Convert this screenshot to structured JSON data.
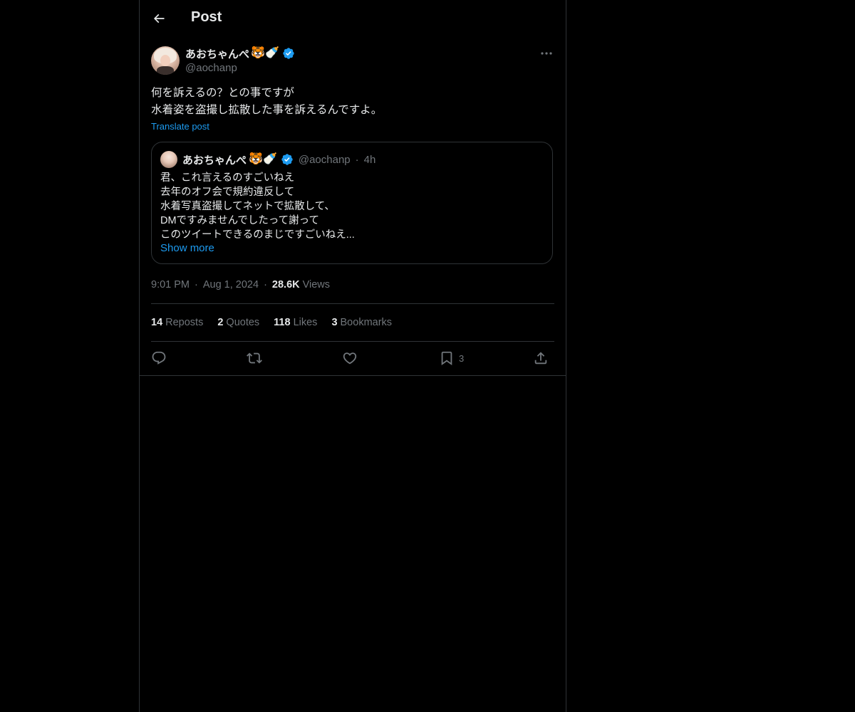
{
  "header": {
    "title": "Post",
    "back_icon": "arrow-left-icon"
  },
  "post": {
    "author": {
      "display_name": "あおちゃんぺ",
      "emojis": "🐯🍼",
      "verified": true,
      "handle": "@aochanp"
    },
    "text_lines": [
      "何を訴えるの？との事ですが",
      "水着姿を盗撮し拡散した事を訴えるんですよ。"
    ],
    "translate_label": "Translate post",
    "quoted": {
      "display_name": "あおちゃんぺ",
      "emojis": "🐯🍼",
      "verified": true,
      "handle": "@aochanp",
      "separator": "·",
      "time": "4h",
      "text_lines": [
        "君、これ言えるのすごいねえ",
        "去年のオフ会で規約違反して",
        "水着写真盗撮してネットで拡散して、",
        "DMですみませんでしたって謝って",
        "このツイートできるのまじですごいねえ..."
      ],
      "show_more_label": "Show more"
    },
    "meta": {
      "time": "9:01 PM",
      "separator": "·",
      "date": "Aug 1, 2024",
      "views_count": "28.6K",
      "views_label": "Views"
    },
    "stats": {
      "reposts_count": "14",
      "reposts_label": "Reposts",
      "quotes_count": "2",
      "quotes_label": "Quotes",
      "likes_count": "118",
      "likes_label": "Likes",
      "bookmarks_count": "3",
      "bookmarks_label": "Bookmarks"
    },
    "actions": {
      "reply_icon": "reply-icon",
      "repost_icon": "repost-icon",
      "like_icon": "heart-icon",
      "bookmark_icon": "bookmark-icon",
      "bookmark_count": "3",
      "share_icon": "share-icon"
    }
  },
  "colors": {
    "background": "#000000",
    "text": "#e7e9ea",
    "secondary": "#71767b",
    "accent": "#1d9bf0",
    "border": "#2f3336"
  }
}
